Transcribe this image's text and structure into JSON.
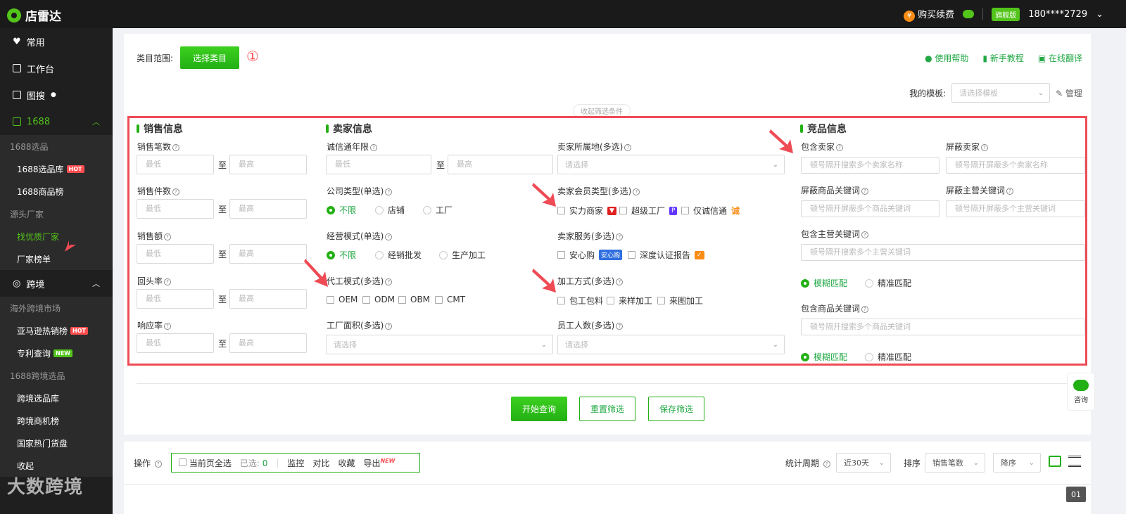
{
  "app": {
    "name": "店雷达"
  },
  "topbar": {
    "buy": "购买续费",
    "yen": "¥",
    "vip": "旗舰版",
    "phone": "180****2729"
  },
  "sidebar": {
    "common": "常用",
    "workbench": "工作台",
    "image_search": "图搜",
    "s1688": "1688",
    "g1_head": "1688选品",
    "g1_items": [
      "1688选品库",
      "1688商品榜"
    ],
    "g2_head": "源头厂家",
    "g2_items": [
      "找优质厂家",
      "厂家榜单"
    ],
    "cross": "跨境",
    "g3_head": "海外跨境市场",
    "g3_items": [
      "亚马逊热销榜",
      "专利查询"
    ],
    "g4_head": "1688跨境选品",
    "g4_items": [
      "跨境选品库",
      "跨境商机榜",
      "国家热门货盘"
    ],
    "collapse": "收起",
    "hot": "HOT",
    "new": "NEW"
  },
  "header": {
    "category_label": "类目范围:",
    "select_btn": "选择类目",
    "marker": "①",
    "help": "使用帮助",
    "tutorial": "新手教程",
    "translate": "在线翻译",
    "template_label": "我的模板:",
    "template_ph": "请选择模板",
    "manage": "管理",
    "collapse": "收起筛选条件"
  },
  "sales": {
    "title": "销售信息",
    "fields": [
      "销售笔数",
      "销售件数",
      "销售额",
      "回头率",
      "响应率"
    ],
    "min": "最低",
    "max": "最高",
    "to": "至"
  },
  "seller": {
    "title": "卖家信息",
    "cert_years": "诚信通年限",
    "company_type": "公司类型(单选)",
    "company_opts": [
      "不限",
      "店铺",
      "工厂"
    ],
    "biz_mode": "经营模式(单选)",
    "biz_opts": [
      "不限",
      "经销批发",
      "生产加工"
    ],
    "oem_mode": "代工模式(多选)",
    "oem_opts": [
      "OEM",
      "ODM",
      "OBM",
      "CMT"
    ],
    "factory_area": "工厂面积(多选)",
    "select_ph": "请选择",
    "location": "卖家所属地(多选)",
    "member_type": "卖家会员类型(多选)",
    "member_opts": [
      "实力商家",
      "超级工厂",
      "仅诚信通"
    ],
    "service": "卖家服务(多选)",
    "service_opts": [
      "安心购",
      "深度认证报告"
    ],
    "service_tag": "安心购",
    "process": "加工方式(多选)",
    "process_opts": [
      "包工包料",
      "来样加工",
      "来图加工"
    ],
    "staff": "员工人数(多选)"
  },
  "compete": {
    "title": "竞品信息",
    "include_seller": "包含卖家",
    "include_seller_ph": "顿号隔开搜索多个卖家名称",
    "block_seller": "屏蔽卖家",
    "block_seller_ph": "顿号隔开屏蔽多个卖家名称",
    "block_kw": "屏蔽商品关键词",
    "block_kw_ph": "顿号隔开屏蔽多个商品关键词",
    "block_main": "屏蔽主营关键词",
    "block_main_ph": "顿号隔开屏蔽多个主营关键词",
    "include_main": "包含主营关键词",
    "include_main_ph": "顿号隔开搜索多个主营关键词",
    "fuzzy": "模糊匹配",
    "exact": "精准匹配",
    "include_kw": "包含商品关键词",
    "include_kw_ph": "顿号隔开搜索多个商品关键词"
  },
  "actions": {
    "search": "开始查询",
    "reset": "重置筛选",
    "save": "保存筛选"
  },
  "ops": {
    "label": "操作",
    "select_all": "当前页全选",
    "selected": "已选:",
    "count": "0",
    "monitor": "监控",
    "compare": "对比",
    "fav": "收藏",
    "export": "导出",
    "export_badge": "NEW",
    "period_label": "统计周期",
    "period": "近30天",
    "sort_label": "排序",
    "sort_by": "销售笔数",
    "order": "降序"
  },
  "consult": "咨询",
  "page": "01",
  "watermark": "大数跨境"
}
